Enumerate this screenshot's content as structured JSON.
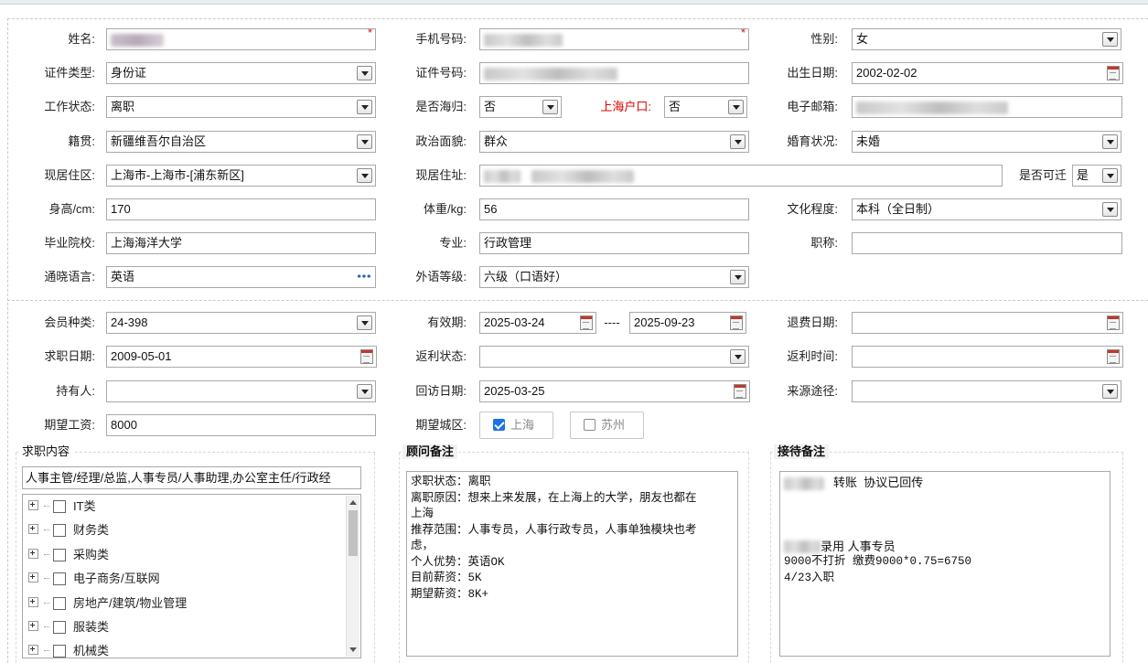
{
  "form": {
    "name": {
      "label": "姓名:"
    },
    "phone": {
      "label": "手机号码:"
    },
    "gender": {
      "label": "性别:",
      "value": "女"
    },
    "id_type": {
      "label": "证件类型:",
      "value": "身份证"
    },
    "id_number": {
      "label": "证件号码:"
    },
    "birth_date": {
      "label": "出生日期:",
      "value": "2002-02-02"
    },
    "work_status": {
      "label": "工作状态:",
      "value": "离职"
    },
    "returnee": {
      "label": "是否海归:",
      "value": "否"
    },
    "shanghai_hukou": {
      "label": "上海户口:",
      "value": "否"
    },
    "email": {
      "label": "电子邮箱:"
    },
    "native_place": {
      "label": "籍贯:",
      "value": "新疆维吾尔自治区"
    },
    "political": {
      "label": "政治面貌:",
      "value": "群众"
    },
    "marital": {
      "label": "婚育状况:",
      "value": "未婚"
    },
    "residence_area": {
      "label": "现居住区:",
      "value": "上海市-上海市-[浦东新区]"
    },
    "residence_address": {
      "label": "现居住址:"
    },
    "relocatable": {
      "label": "是否可迁",
      "value": "是"
    },
    "height": {
      "label": "身高/cm:",
      "value": "170"
    },
    "weight": {
      "label": "体重/kg:",
      "value": "56"
    },
    "education": {
      "label": "文化程度:",
      "value": "本科（全日制）"
    },
    "school": {
      "label": "毕业院校:",
      "value": "上海海洋大学"
    },
    "major": {
      "label": "专业:",
      "value": "行政管理"
    },
    "title": {
      "label": "职称:",
      "value": ""
    },
    "language": {
      "label": "通晓语言:",
      "value": "英语"
    },
    "lang_level": {
      "label": "外语等级:",
      "value": "六级（口语好）"
    },
    "member_type": {
      "label": "会员种类:",
      "value": "24-398"
    },
    "valid_period": {
      "label": "有效期:",
      "from": "2025-03-24",
      "sep": "----",
      "to": "2025-09-23"
    },
    "refund_date": {
      "label": "退费日期:",
      "value": ""
    },
    "job_date": {
      "label": "求职日期:",
      "value": "2009-05-01"
    },
    "rebate_status": {
      "label": "返利状态:",
      "value": ""
    },
    "rebate_time": {
      "label": "返利时间:",
      "value": ""
    },
    "holder": {
      "label": "持有人:",
      "value": ""
    },
    "visit_date": {
      "label": "回访日期:",
      "value": "2025-03-25"
    },
    "source": {
      "label": "来源途径:",
      "value": ""
    },
    "expected_salary": {
      "label": "期望工资:",
      "value": "8000"
    },
    "expected_city": {
      "label": "期望城区:",
      "options": [
        {
          "label": "上海",
          "checked": true
        },
        {
          "label": "苏州",
          "checked": false
        }
      ]
    }
  },
  "job_content": {
    "title": "求职内容",
    "selected": "人事主管/经理/总监,人事专员/人事助理,办公室主任/行政经",
    "tree": [
      "IT类",
      "财务类",
      "采购类",
      "电子商务/互联网",
      "房地产/建筑/物业管理",
      "服装类",
      "机械类"
    ]
  },
  "advisor_notes": {
    "title": "顾问备注",
    "lines": [
      "求职状态：离职",
      "离职原因：想来上来发展，在上海上的大学，朋友也都在",
      "上海",
      "推荐范围：人事专员，人事行政专员，人事单独模块也考",
      "虑，",
      "个人优势：英语OK",
      "目前薪资：5K",
      "期望薪资：8K+"
    ]
  },
  "reception_notes": {
    "title": "接待备注",
    "line1": "转账  协议已回传",
    "line2": "录用 人事专员",
    "line3": "9000不打折 缴费9000*0.75=6750",
    "line4": "4/23入职"
  },
  "colors": {
    "required": "#e00000",
    "checkbox_accent": "#1a73e8",
    "field_border": "#a9a9a9"
  },
  "icons": [
    "dropdown-arrow-icon",
    "calendar-icon",
    "more-dots-icon",
    "checkbox-icon",
    "tree-expand-icon"
  ]
}
